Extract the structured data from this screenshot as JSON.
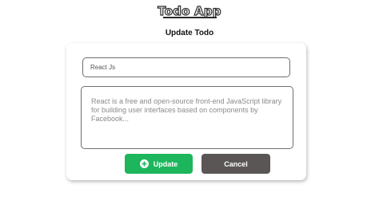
{
  "app": {
    "title": "Todo App"
  },
  "page": {
    "title": "Update Todo"
  },
  "form": {
    "title_value": "React Js",
    "description_value": "React is a free and open-source front-end JavaScript library for building user interfaces based on components by Facebook...",
    "update_label": "Update",
    "update_icon": "plus-circle-icon",
    "cancel_label": "Cancel"
  },
  "colors": {
    "update_button": "#1db65d",
    "cancel_button": "#5a5655",
    "title_stroke": "#2a2a2a"
  }
}
